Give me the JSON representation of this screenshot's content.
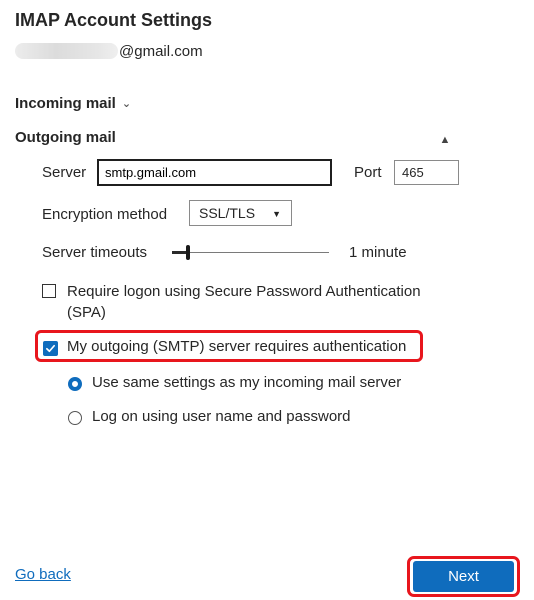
{
  "header": {
    "title": "IMAP Account Settings",
    "email_suffix": "@gmail.com"
  },
  "sections": {
    "incoming_label": "Incoming mail",
    "outgoing_label": "Outgoing mail",
    "incoming_icon": "chevron-down-icon",
    "outgoing_icon": "chevron-up-icon"
  },
  "outgoing": {
    "server_label": "Server",
    "server_value": "smtp.gmail.com",
    "port_label": "Port",
    "port_value": "465",
    "encryption_label": "Encryption method",
    "encryption_value": "SSL/TLS",
    "timeouts_label": "Server timeouts",
    "timeouts_value": "1 minute",
    "timeouts_slider_fraction": 0.1,
    "spa_label": "Require logon using Secure Password Authentication (SPA)",
    "spa_checked": false,
    "smtp_auth_label": "My outgoing (SMTP) server requires authentication",
    "smtp_auth_checked": true,
    "auth_options": [
      {
        "label": "Use same settings as my incoming mail server",
        "selected": true
      },
      {
        "label": "Log on using user name and password",
        "selected": false
      }
    ]
  },
  "footer": {
    "go_back": "Go back",
    "next": "Next"
  },
  "colors": {
    "accent": "#0f6cbd",
    "highlight": "#e8161d"
  }
}
